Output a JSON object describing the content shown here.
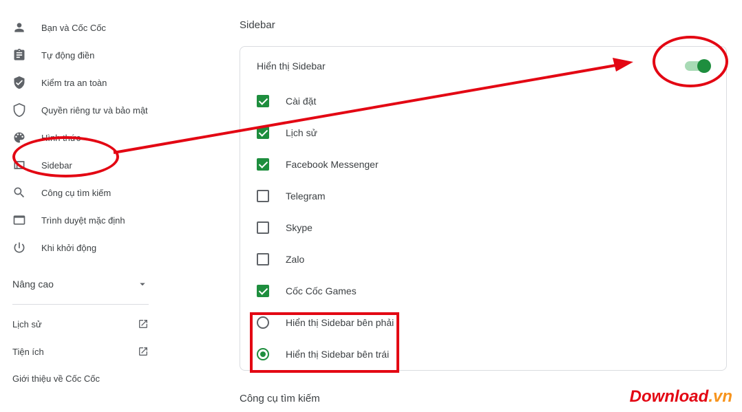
{
  "sidebar": {
    "items": [
      {
        "label": "Bạn và Cốc Cốc"
      },
      {
        "label": "Tự động điền"
      },
      {
        "label": "Kiểm tra an toàn"
      },
      {
        "label": "Quyền riêng tư và bảo mật"
      },
      {
        "label": "Hình thức"
      },
      {
        "label": "Sidebar"
      },
      {
        "label": "Công cụ tìm kiếm"
      },
      {
        "label": "Trình duyệt mặc định"
      },
      {
        "label": "Khi khởi động"
      }
    ],
    "advanced": "Nâng cao",
    "links": [
      {
        "label": "Lịch sử"
      },
      {
        "label": "Tiện ích"
      },
      {
        "label": "Giới thiệu về Cốc Cốc"
      }
    ]
  },
  "main": {
    "title": "Sidebar",
    "toggle_label": "Hiển thị Sidebar",
    "options": [
      {
        "label": "Cài đặt",
        "type": "checkbox",
        "checked": true
      },
      {
        "label": "Lịch sử",
        "type": "checkbox",
        "checked": true
      },
      {
        "label": "Facebook Messenger",
        "type": "checkbox",
        "checked": true
      },
      {
        "label": "Telegram",
        "type": "checkbox",
        "checked": false
      },
      {
        "label": "Skype",
        "type": "checkbox",
        "checked": false
      },
      {
        "label": "Zalo",
        "type": "checkbox",
        "checked": false
      },
      {
        "label": "Cốc Cốc Games",
        "type": "checkbox",
        "checked": true
      }
    ],
    "radios": [
      {
        "label": "Hiển thị Sidebar bên phải",
        "checked": false
      },
      {
        "label": "Hiển thị Sidebar bên trái",
        "checked": true
      }
    ],
    "next_title": "Công cụ tìm kiếm"
  },
  "watermark": {
    "brand": "Download",
    "suffix": ".vn"
  }
}
